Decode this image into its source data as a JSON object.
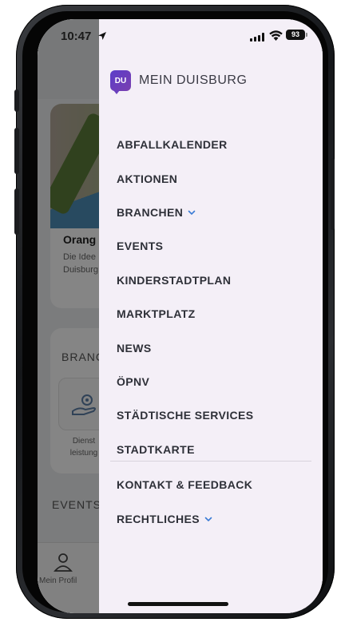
{
  "status": {
    "time": "10:47",
    "battery": "93"
  },
  "brand": {
    "logo_text": "DU",
    "name": "MEIN DUISBURG"
  },
  "menu": [
    {
      "label": "ABFALLKALENDER",
      "expandable": false
    },
    {
      "label": "AKTIONEN",
      "expandable": false
    },
    {
      "label": "BRANCHEN",
      "expandable": true
    },
    {
      "label": "EVENTS",
      "expandable": false
    },
    {
      "label": "KINDERSTADTPLAN",
      "expandable": false
    },
    {
      "label": "MARKTPLATZ",
      "expandable": false
    },
    {
      "label": "NEWS",
      "expandable": false
    },
    {
      "label": "ÖPNV",
      "expandable": false
    },
    {
      "label": "STÄDTISCHE SERVICES",
      "expandable": false
    },
    {
      "label": "STADTKARTE",
      "expandable": false
    }
  ],
  "menu_secondary": [
    {
      "label": "KONTAKT & FEEDBACK",
      "expandable": false
    },
    {
      "label": "RECHTLICHES",
      "expandable": true
    }
  ],
  "background": {
    "card_title": "Orang",
    "card_text": "Die Idee\nDuisburg",
    "branchen_label": "BRANC",
    "service_label": "Dienst\nleistung",
    "events_label": "EVENTS",
    "profile_label": "Mein Profil"
  },
  "colors": {
    "accent": "#3a7bd5",
    "drawer_bg": "#f4eff7",
    "logo": "#5b3ec9"
  }
}
